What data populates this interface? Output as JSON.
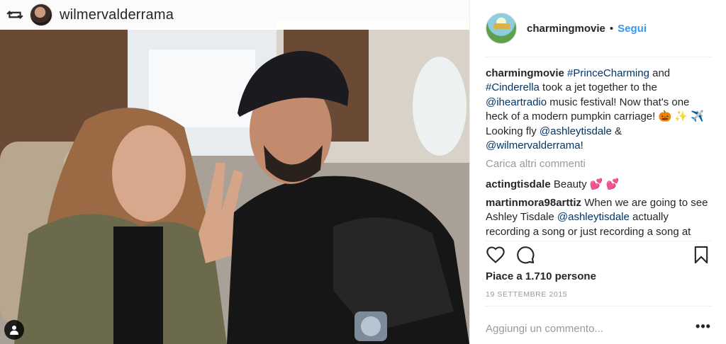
{
  "photo": {
    "repost_user": "wilmervalderrama"
  },
  "post": {
    "author": "charmingmovie",
    "separator": "•",
    "follow_label": "Segui",
    "caption": {
      "author": "charmingmovie",
      "tag1": "#PrinceCharming",
      "t1": " and ",
      "tag2": "#Cinderella",
      "t2": " took a jet together to the ",
      "mention1": "@iheartradio",
      "t3": " music festival! Now that's one heck of a modern pumpkin carriage! 🎃 ✨ ✈️  Looking fly ",
      "mention2": "@ashleytisdale",
      "t4": " & ",
      "mention3": "@wilmervalderrama",
      "t5": "!"
    },
    "load_more_label": "Carica altri commenti",
    "comments": [
      {
        "user": "actingtisdale",
        "text_a": "Beauty ",
        "text_b": "💕 💕",
        "mention": "",
        "text_c": ""
      },
      {
        "user": "martinmora98arttiz",
        "text_a": "When we are going to see Ashley Tisdale ",
        "text_b": "",
        "mention": "@ashleytisdale",
        "text_c": " actually recording a song or just recording a song at"
      }
    ],
    "likes_label": "Piace a 1.710 persone",
    "date": "19 SETTEMBRE 2015",
    "add_comment_placeholder": "Aggiungi un commento...",
    "more_label": "•••"
  },
  "icons": {
    "repost": "repost-icon",
    "tag": "user-tag-icon",
    "like": "heart-icon",
    "comment": "comment-icon",
    "save": "bookmark-icon",
    "more": "more-options-icon"
  },
  "colors": {
    "link": "#003569",
    "follow": "#3897f0",
    "muted": "#999999",
    "text": "#262626"
  }
}
